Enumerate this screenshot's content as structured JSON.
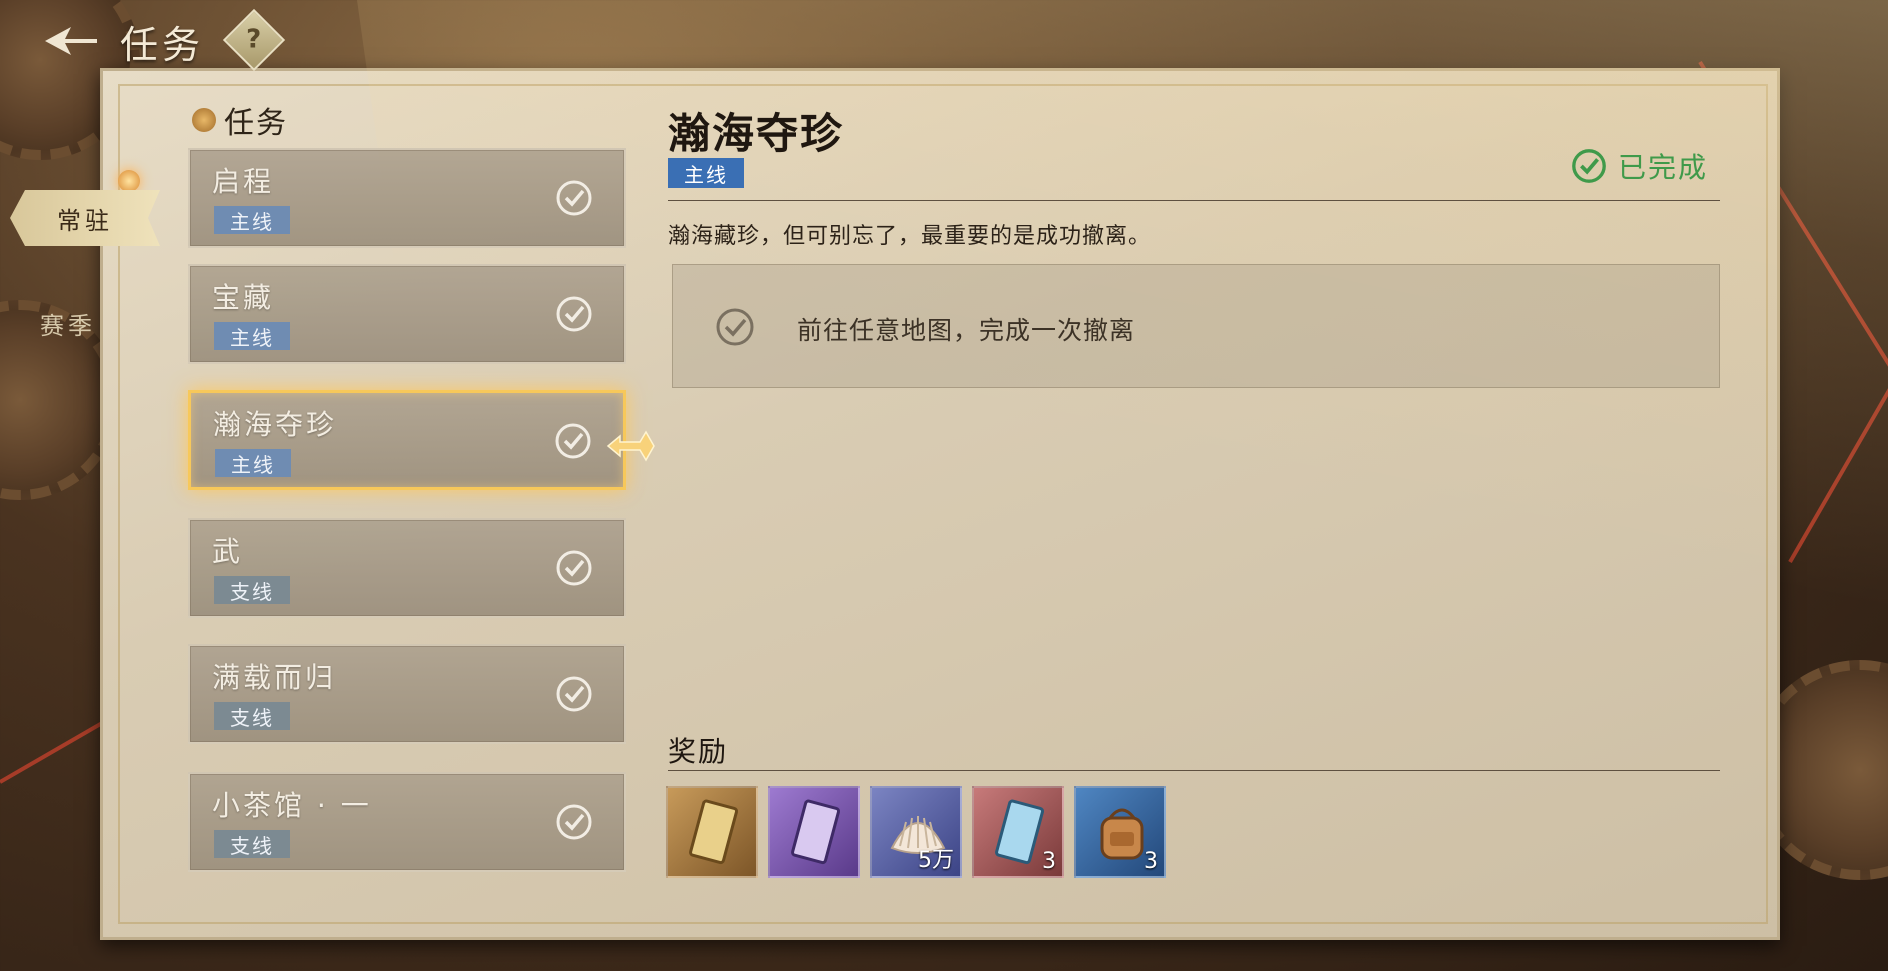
{
  "header": {
    "title": "任务",
    "help_label": "?"
  },
  "side_tabs": [
    {
      "label": "常驻",
      "active": true
    },
    {
      "label": "赛季",
      "active": false
    }
  ],
  "quest_list": {
    "header": "任务",
    "items": [
      {
        "name": "启程",
        "tag": "主线",
        "completed": true,
        "selected": false
      },
      {
        "name": "宝藏",
        "tag": "主线",
        "completed": true,
        "selected": false
      },
      {
        "name": "瀚海夺珍",
        "tag": "主线",
        "completed": true,
        "selected": true
      },
      {
        "name": "武",
        "tag": "支线",
        "completed": true,
        "selected": false
      },
      {
        "name": "满载而归",
        "tag": "支线",
        "completed": true,
        "selected": false
      },
      {
        "name": "小茶馆 · 一",
        "tag": "支线",
        "completed": true,
        "selected": false
      }
    ]
  },
  "detail": {
    "title": "瀚海夺珍",
    "tag": "主线",
    "status": "已完成",
    "description": "瀚海藏珍，但可别忘了，最重要的是成功撤离。",
    "objective": "前往任意地图，完成一次撤离",
    "rewards_title": "奖励",
    "rewards": [
      {
        "icon": "gold-card-icon",
        "qty": ""
      },
      {
        "icon": "purple-card-icon",
        "qty": ""
      },
      {
        "icon": "shell-icon",
        "qty": "5万"
      },
      {
        "icon": "blue-card-icon",
        "qty": "3"
      },
      {
        "icon": "backpack-icon",
        "qty": "3"
      }
    ]
  },
  "colors": {
    "main_tag": "#3a6fb4",
    "completed_green": "#3f9a4a",
    "selected_glow": "#f7c85a"
  }
}
